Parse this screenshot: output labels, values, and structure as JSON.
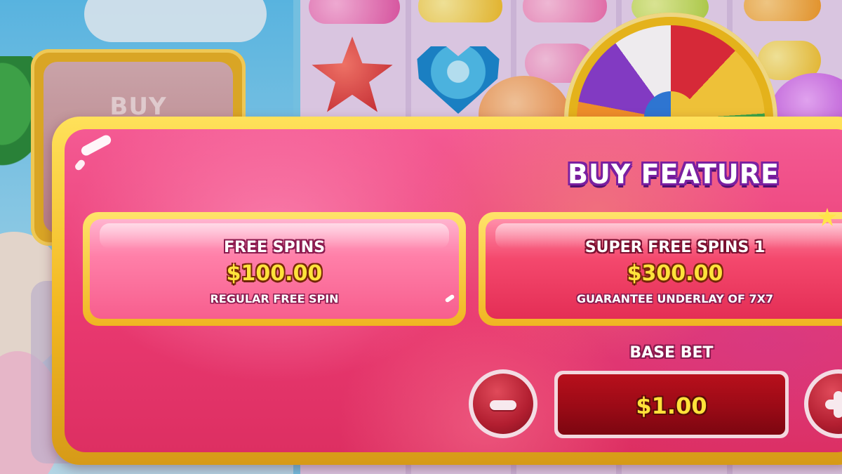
{
  "background": {
    "side_button_label": "BUY"
  },
  "buy_feature": {
    "title": "BUY FEATURE",
    "options": [
      {
        "name": "FREE SPINS",
        "price": "$100.00",
        "description": "REGULAR FREE SPIN"
      },
      {
        "name": "SUPER FREE SPINS 1",
        "price": "$300.00",
        "description": "GUARANTEE UNDERLAY OF 7X7"
      }
    ],
    "base_bet": {
      "label": "BASE BET",
      "value": "$1.00"
    }
  },
  "icons": {
    "minus": "minus-icon",
    "plus": "plus-icon",
    "star": "star-icon"
  },
  "colors": {
    "panel_pink": "#e8386f",
    "frame_gold": "#f2b821",
    "price_yellow": "#ffe33b",
    "title_outline": "#7a1fa0",
    "bet_box_red": "#9a0a16"
  }
}
